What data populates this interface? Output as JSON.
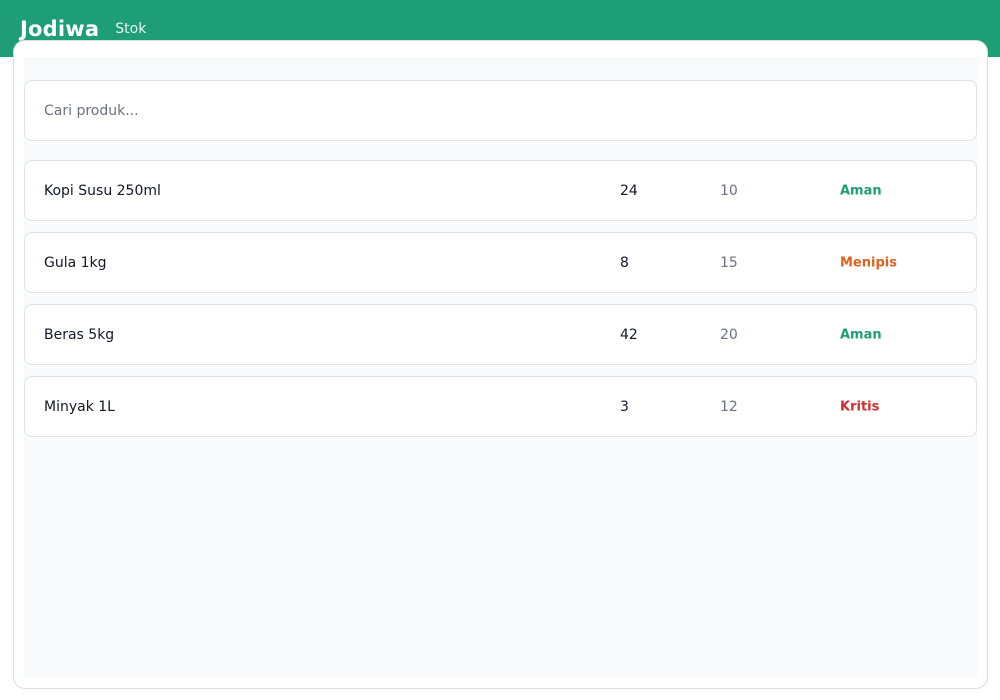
{
  "header": {
    "brand": "Jodiwa",
    "nav_label": "Stok",
    "color": "#1e9e74"
  },
  "search": {
    "placeholder": "Cari produk...",
    "value": ""
  },
  "status_colors": {
    "Aman": "#1e9e74",
    "Menipis": "#e0601c",
    "Kritis": "#d12d2d"
  },
  "products": [
    {
      "name": "Kopi Susu 250ml",
      "qty": "24",
      "min": "10",
      "status": "Aman"
    },
    {
      "name": "Gula 1kg",
      "qty": "8",
      "min": "15",
      "status": "Menipis"
    },
    {
      "name": "Beras 5kg",
      "qty": "42",
      "min": "20",
      "status": "Aman"
    },
    {
      "name": "Minyak 1L",
      "qty": "3",
      "min": "12",
      "status": "Kritis"
    }
  ]
}
